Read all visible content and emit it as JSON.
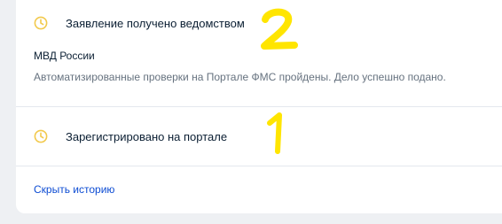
{
  "history": {
    "events": [
      {
        "status": "Заявление получено ведомством",
        "agency": "МВД России",
        "description": "Автоматизированные проверки на Портале ФМС пройдены. Дело успешно подано.",
        "icon": "clock-icon",
        "icon_color": "#f2c94c"
      },
      {
        "status": "Зарегистрировано на портале",
        "icon": "clock-icon",
        "icon_color": "#f2c94c"
      }
    ],
    "hide_link_label": "Скрыть историю",
    "link_color": "#0d4cd3"
  },
  "annotations": {
    "labels": [
      "2",
      "1"
    ],
    "color": "#ffe500"
  }
}
